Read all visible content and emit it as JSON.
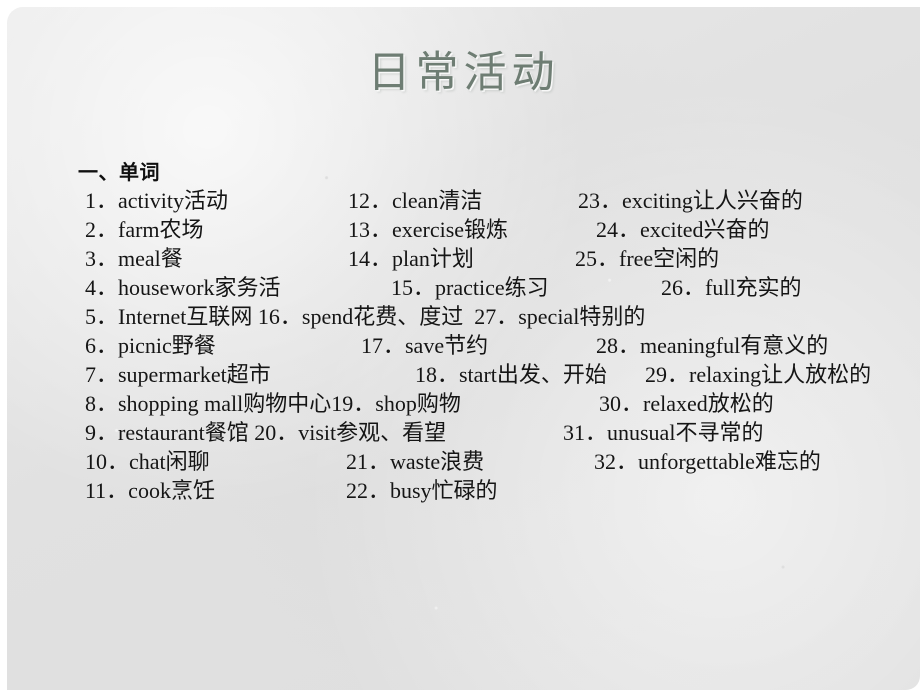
{
  "slide": {
    "title": "日常活动",
    "title_color": "#6e7d73",
    "background_color": "#e3e3e3",
    "text_color": "#141414"
  },
  "section": {
    "heading": "一、单词"
  },
  "lines": [
    {
      "segments": [
        {
          "text": "1．activity活动",
          "indent": 7
        },
        {
          "text": "12．clean清洁",
          "indent": 270
        },
        {
          "text": "23．exciting让人兴奋的",
          "indent": 500
        }
      ]
    },
    {
      "segments": [
        {
          "text": "2．farm农场",
          "indent": 7
        },
        {
          "text": "13．exercise锻炼",
          "indent": 270
        },
        {
          "text": "24．excited兴奋的",
          "indent": 518
        }
      ]
    },
    {
      "segments": [
        {
          "text": "3．meal餐",
          "indent": 7
        },
        {
          "text": "14．plan计划",
          "indent": 270
        },
        {
          "text": "25．free空闲的",
          "indent": 497
        }
      ]
    },
    {
      "segments": [
        {
          "text": "4．housework家务活",
          "indent": 7
        },
        {
          "text": "15．practice练习",
          "indent": 313
        },
        {
          "text": "26．full充实的",
          "indent": 583
        }
      ]
    },
    {
      "segments": [
        {
          "text": "5．Internet互联网 16．spend花费、度过  27．special特别的",
          "indent": 7
        }
      ]
    },
    {
      "segments": [
        {
          "text": "6．picnic野餐",
          "indent": 7
        },
        {
          "text": "17．save节约",
          "indent": 283
        },
        {
          "text": "28．meaningful有意义的",
          "indent": 518
        }
      ]
    },
    {
      "segments": [
        {
          "text": "7．supermarket超市",
          "indent": 7
        },
        {
          "text": "18．start出发、开始",
          "indent": 337
        },
        {
          "text": "29．relaxing让人放松的",
          "indent": 567
        }
      ]
    },
    {
      "segments": [
        {
          "text": "8．shopping mall购物中心19．shop购物",
          "indent": 7
        },
        {
          "text": "30．relaxed放松的",
          "indent": 521
        }
      ]
    },
    {
      "segments": [
        {
          "text": "9．restaurant餐馆 20．visit参观、看望",
          "indent": 7
        },
        {
          "text": "31．unusual不寻常的",
          "indent": 485
        }
      ]
    },
    {
      "segments": [
        {
          "text": "10．chat闲聊",
          "indent": 7
        },
        {
          "text": "21．waste浪费",
          "indent": 268
        },
        {
          "text": "32．unforgettable难忘的",
          "indent": 516
        }
      ]
    },
    {
      "segments": [
        {
          "text": "11．cook烹饪",
          "indent": 7
        },
        {
          "text": "22．busy忙碌的",
          "indent": 268
        }
      ]
    }
  ]
}
